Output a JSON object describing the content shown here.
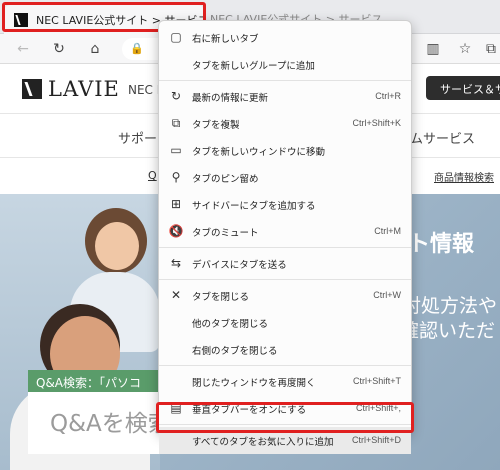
{
  "browser": {
    "active_tab": {
      "title": "NEC LAVIE公式サイト > サービス",
      "icon": "nec-favicon"
    },
    "inactive_tab": {
      "title": "NEC LAVIE公式サイト > サービス"
    },
    "toolbar": {
      "back": "←",
      "reload": "↻",
      "home": "⌂",
      "right_icons": [
        "split-screen-icon",
        "favorites-icon",
        "collections-icon"
      ]
    }
  },
  "site": {
    "logo_text": "LAVIE",
    "site_name": "NEC L",
    "services_button": "サービス＆サ",
    "nav_left": "サポー",
    "nav_right": "ムサービス",
    "sub_left": "Q",
    "sub_right": "商品情報検索",
    "hero_title": "ト情報",
    "hero_text1": "対処方法や",
    "hero_text2": "確認いただ",
    "qa_label": "Q&A検索：「パソコ",
    "qa_placeholder": "Q&Aを検索"
  },
  "context_menu": {
    "items": [
      {
        "label": "右に新しいタブ",
        "shortcut": "",
        "icon": "new-tab-icon",
        "glyph": "▢"
      },
      {
        "label": "タブを新しいグループに追加",
        "shortcut": "",
        "icon": "none",
        "glyph": ""
      },
      {
        "label": "最新の情報に更新",
        "shortcut": "Ctrl+R",
        "icon": "refresh-icon",
        "glyph": "↻"
      },
      {
        "label": "タブを複製",
        "shortcut": "Ctrl+Shift+K",
        "icon": "duplicate-icon",
        "glyph": "⧉"
      },
      {
        "label": "タブを新しいウィンドウに移動",
        "shortcut": "",
        "icon": "window-icon",
        "glyph": "▭"
      },
      {
        "label": "タブのピン留め",
        "shortcut": "",
        "icon": "pin-icon",
        "glyph": "⚲"
      },
      {
        "label": "サイドバーにタブを追加する",
        "shortcut": "",
        "icon": "sidebar-add-icon",
        "glyph": "⊞"
      },
      {
        "label": "タブのミュート",
        "shortcut": "Ctrl+M",
        "icon": "mute-icon",
        "glyph": "🔇"
      },
      {
        "label": "デバイスにタブを送る",
        "shortcut": "",
        "icon": "send-device-icon",
        "glyph": "⇆"
      },
      {
        "label": "タブを閉じる",
        "shortcut": "Ctrl+W",
        "icon": "close-icon",
        "glyph": "✕"
      },
      {
        "label": "他のタブを閉じる",
        "shortcut": "",
        "icon": "none",
        "glyph": ""
      },
      {
        "label": "右側のタブを閉じる",
        "shortcut": "",
        "icon": "none",
        "glyph": ""
      },
      {
        "label": "閉じたウィンドウを再度開く",
        "shortcut": "Ctrl+Shift+T",
        "icon": "none",
        "glyph": ""
      },
      {
        "label": "垂直タブバーをオンにする",
        "shortcut": "Ctrl+Shift+,",
        "icon": "vertical-tabs-icon",
        "glyph": "▤"
      },
      {
        "label": "すべてのタブをお気に入りに追加",
        "shortcut": "Ctrl+Shift+D",
        "icon": "none",
        "glyph": ""
      }
    ]
  },
  "colors": {
    "highlight": "#e02020",
    "qa_green": "#5a9c6a"
  }
}
